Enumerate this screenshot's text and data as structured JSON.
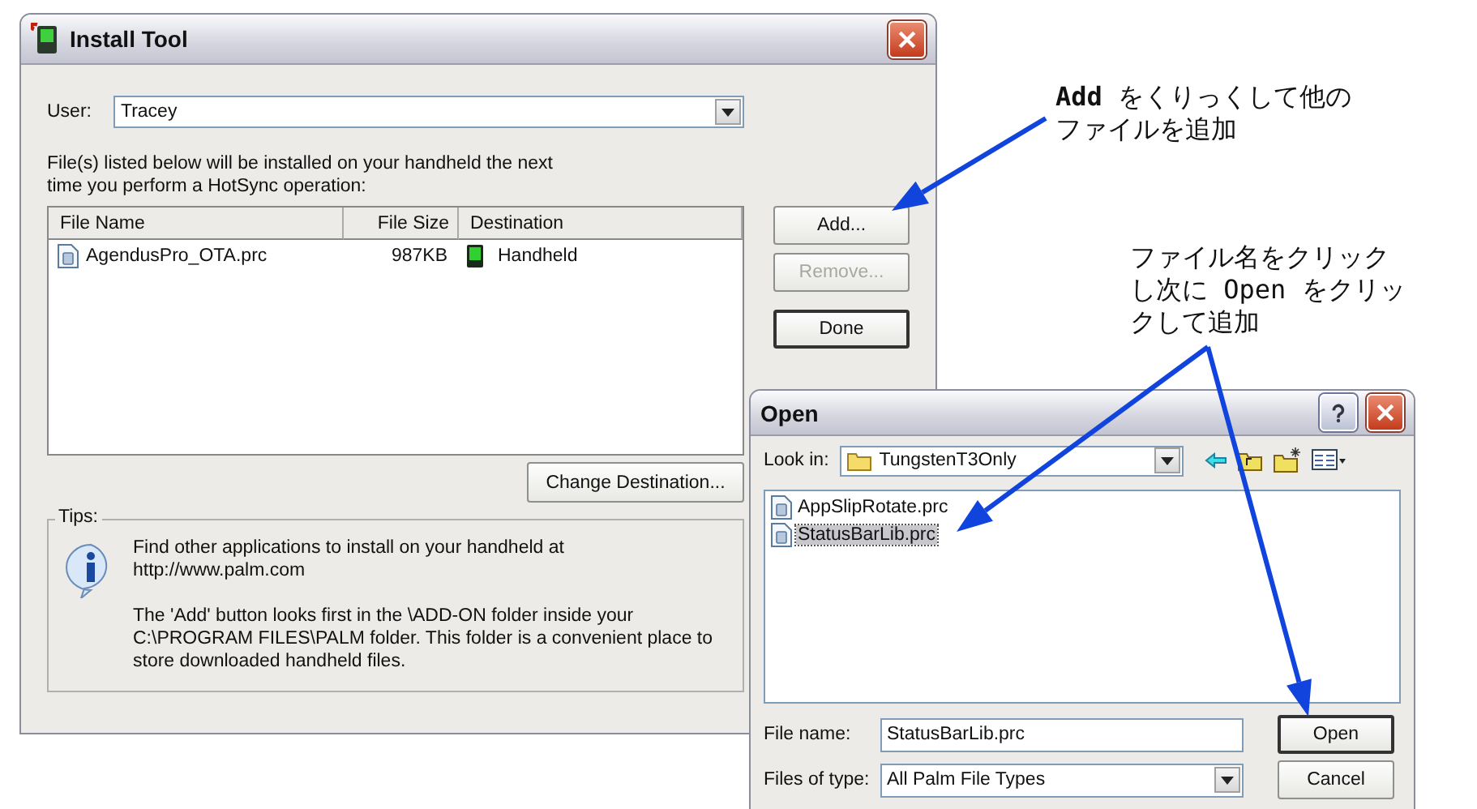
{
  "install_tool": {
    "title": "Install Tool",
    "user_label": "User:",
    "user_value": "Tracey",
    "intro": "File(s) listed below will be installed on your handheld the next time you perform a HotSync operation:",
    "table": {
      "columns": [
        "File Name",
        "File Size",
        "Destination"
      ],
      "rows": [
        {
          "file_name": "AgendusPro_OTA.prc",
          "file_size": "987KB",
          "destination": "Handheld"
        }
      ]
    },
    "buttons": [
      {
        "label": "Add...",
        "disabled": false,
        "default": false
      },
      {
        "label": "Remove...",
        "disabled": true,
        "default": false
      },
      {
        "label": "Done",
        "disabled": false,
        "default": true
      }
    ],
    "change_destination": "Change Destination...",
    "tips": {
      "title": "Tips:",
      "paragraphs": [
        "Find other applications to install on your handheld at http://www.palm.com",
        "The 'Add' button looks first in the \\ADD-ON folder inside your C:\\PROGRAM FILES\\PALM folder. This folder is a convenient place to store downloaded handheld files."
      ]
    }
  },
  "open_dialog": {
    "title": "Open",
    "look_in_label": "Look in:",
    "look_in_value": "TungstenT3Only",
    "files": [
      {
        "name": "AppSlipRotate.prc",
        "selected": false
      },
      {
        "name": "StatusBarLib.prc",
        "selected": true
      }
    ],
    "file_name_label": "File name:",
    "file_name_value": "StatusBarLib.prc",
    "file_type_label": "Files of type:",
    "file_type_value": "All Palm File Types",
    "buttons": [
      {
        "label": "Open",
        "default": true
      },
      {
        "label": "Cancel",
        "default": false
      }
    ]
  },
  "annotations": [
    {
      "text": "**Add** をくりっくして他のファイルを追加"
    },
    {
      "text": "ファイル名をクリックし次に Open をクリックして追加"
    }
  ]
}
